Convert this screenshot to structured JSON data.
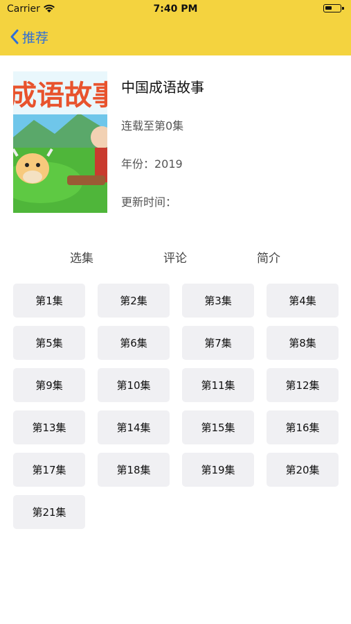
{
  "status": {
    "carrier": "Carrier",
    "time": "7:40 PM"
  },
  "nav": {
    "back_label": "推荐"
  },
  "detail": {
    "cover_text": "成语故事",
    "title": "中国成语故事",
    "progress": "连载至第0集",
    "year": "年份：2019",
    "updated": "更新时间："
  },
  "tabs": [
    "选集",
    "评论",
    "简介"
  ],
  "episodes": [
    "第1集",
    "第2集",
    "第3集",
    "第4集",
    "第5集",
    "第6集",
    "第7集",
    "第8集",
    "第9集",
    "第10集",
    "第11集",
    "第12集",
    "第13集",
    "第14集",
    "第15集",
    "第16集",
    "第17集",
    "第18集",
    "第19集",
    "第20集",
    "第21集"
  ],
  "colors": {
    "header": "#f4d33f",
    "link": "#2f6fd6",
    "episode_bg": "#f0f0f3"
  }
}
